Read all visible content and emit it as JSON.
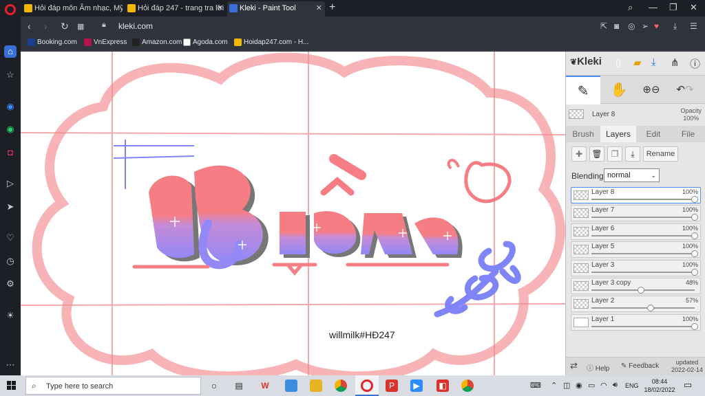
{
  "browser": {
    "tabs": [
      {
        "label": "Hỏi đáp môn Âm nhạc, Mỹ",
        "fav_color": "#f2b705"
      },
      {
        "label": "Hỏi đáp 247 - trang tra lời",
        "fav_color": "#f2b705"
      },
      {
        "label": "Kleki - Paint Tool",
        "fav_color": "#3b6fd8"
      }
    ],
    "new_tab": "+",
    "url": "kleki.com",
    "bookmarks": [
      {
        "label": "Booking.com",
        "fav_color": "#1a3f8f"
      },
      {
        "label": "VnExpress",
        "fav_color": "#b5134b"
      },
      {
        "label": "Amazon.com",
        "fav_color": "#222222"
      },
      {
        "label": "Agoda.com",
        "fav_color": "#ffffff"
      },
      {
        "label": "Hoidap247.com - H...",
        "fav_color": "#f2b705"
      }
    ]
  },
  "canvas": {
    "watermark": "willmilk#HĐ247",
    "lettering": "Buồn",
    "colors": {
      "pink": "#f7a5a8",
      "grid": "#f08b90",
      "blue": "#7f84f7",
      "shadow": "#777777"
    }
  },
  "kleki": {
    "logo": "Kleki",
    "current_layer": "Layer 8",
    "opacity_label": "Opacity",
    "opacity_value": "100%",
    "tabs": [
      "Brush",
      "Layers",
      "Edit",
      "File"
    ],
    "selected_tab": "Layers",
    "rename_label": "Rename",
    "blending_label": "Blending",
    "blending_value": "normal",
    "layers": [
      {
        "name": "Layer 8",
        "opacity": "100%",
        "value": 1.0,
        "selected": true
      },
      {
        "name": "Layer 7",
        "opacity": "100%",
        "value": 1.0
      },
      {
        "name": "Layer 6",
        "opacity": "100%",
        "value": 1.0
      },
      {
        "name": "Layer 5",
        "opacity": "100%",
        "value": 1.0
      },
      {
        "name": "Layer 3",
        "opacity": "100%",
        "value": 1.0
      },
      {
        "name": "Layer 3 copy",
        "opacity": "48%",
        "value": 0.48
      },
      {
        "name": "Layer 2",
        "opacity": "57%",
        "value": 0.57
      },
      {
        "name": "Layer 1",
        "opacity": "100%",
        "value": 1.0
      }
    ],
    "help_label": "Help",
    "feedback_label": "Feedback",
    "updated_label": "updated",
    "updated_date": "2022-02-14"
  },
  "taskbar": {
    "search_placeholder": "Type here to search",
    "lang": "ENG",
    "time": "08:44",
    "date": "18/02/2022"
  }
}
